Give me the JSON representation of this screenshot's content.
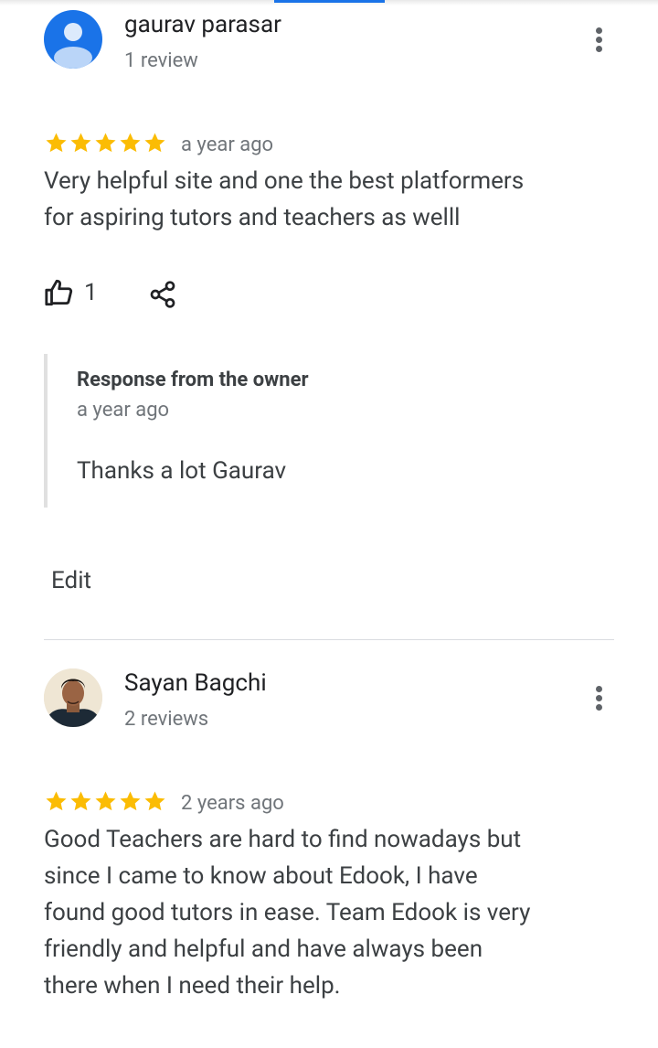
{
  "colors": {
    "accent": "#1a73e8",
    "star": "#fbbc04",
    "avatar_blue": "#1a73e8"
  },
  "reviews": [
    {
      "author": "gaurav parasar",
      "review_count": "1 review",
      "rating": 5,
      "date": "a year ago",
      "text_lines": [
        "Very helpful site and one the best platformers",
        "for aspiring tutors and teachers as welll"
      ],
      "likes": "1",
      "owner_response": {
        "title": "Response from the owner",
        "date": "a year ago",
        "text": "Thanks a lot Gaurav"
      },
      "edit_label": "Edit"
    },
    {
      "author": "Sayan Bagchi",
      "review_count": "2 reviews",
      "rating": 5,
      "date": "2 years ago",
      "text_lines": [
        "Good Teachers are hard to find nowadays but",
        "since I came to know about Edook, I have",
        "found good tutors in ease. Team Edook is very",
        "friendly and helpful and have always been",
        "there when I need their help."
      ]
    }
  ]
}
